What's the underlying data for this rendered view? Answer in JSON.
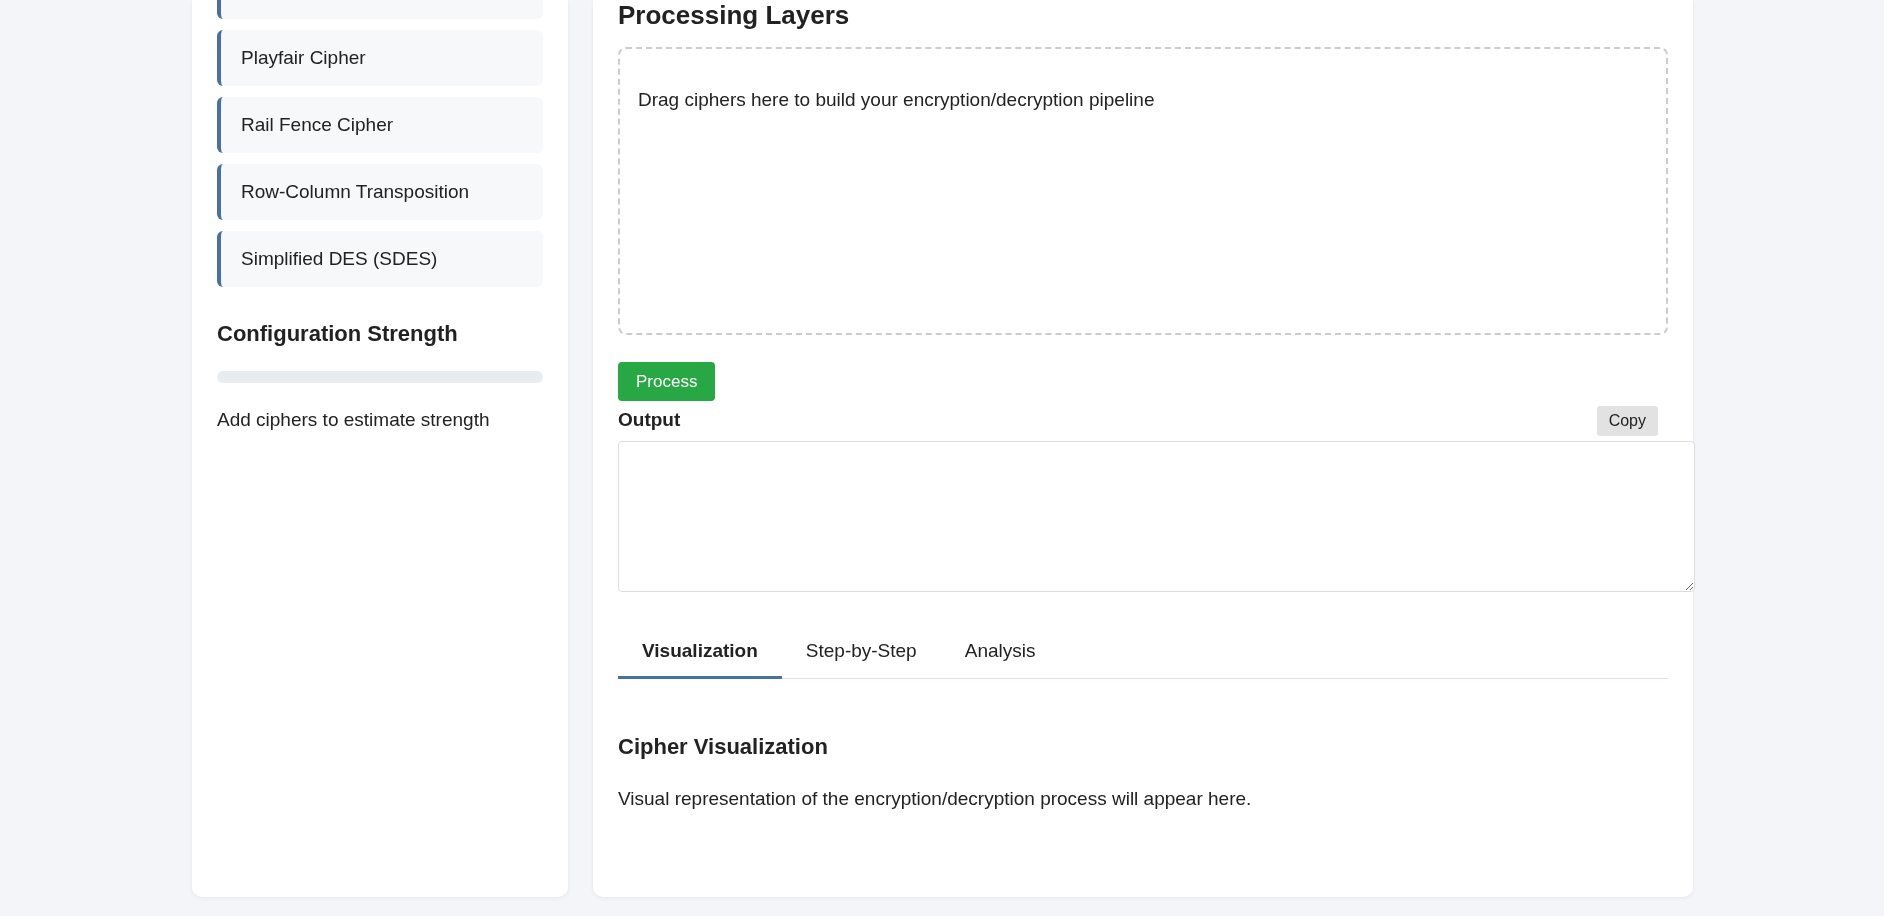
{
  "sidebar": {
    "ciphers": [
      {
        "label": "Playfair Cipher"
      },
      {
        "label": "Rail Fence Cipher"
      },
      {
        "label": "Row-Column Transposition"
      },
      {
        "label": "Simplified DES (SDES)"
      }
    ],
    "strength": {
      "title": "Configuration Strength",
      "message": "Add ciphers to estimate strength"
    }
  },
  "main": {
    "title": "Processing Layers",
    "drop_zone": {
      "hint": "Drag ciphers here to build your encryption/decryption pipeline"
    },
    "process_button": "Process",
    "output": {
      "label": "Output",
      "copy_button": "Copy"
    },
    "tabs": [
      {
        "label": "Visualization",
        "selected": true
      },
      {
        "label": "Step-by-Step",
        "selected": false
      },
      {
        "label": "Analysis",
        "selected": false
      }
    ],
    "panel": {
      "title": "Cipher Visualization",
      "text": "Visual representation of the encryption/decryption process will appear here."
    }
  }
}
